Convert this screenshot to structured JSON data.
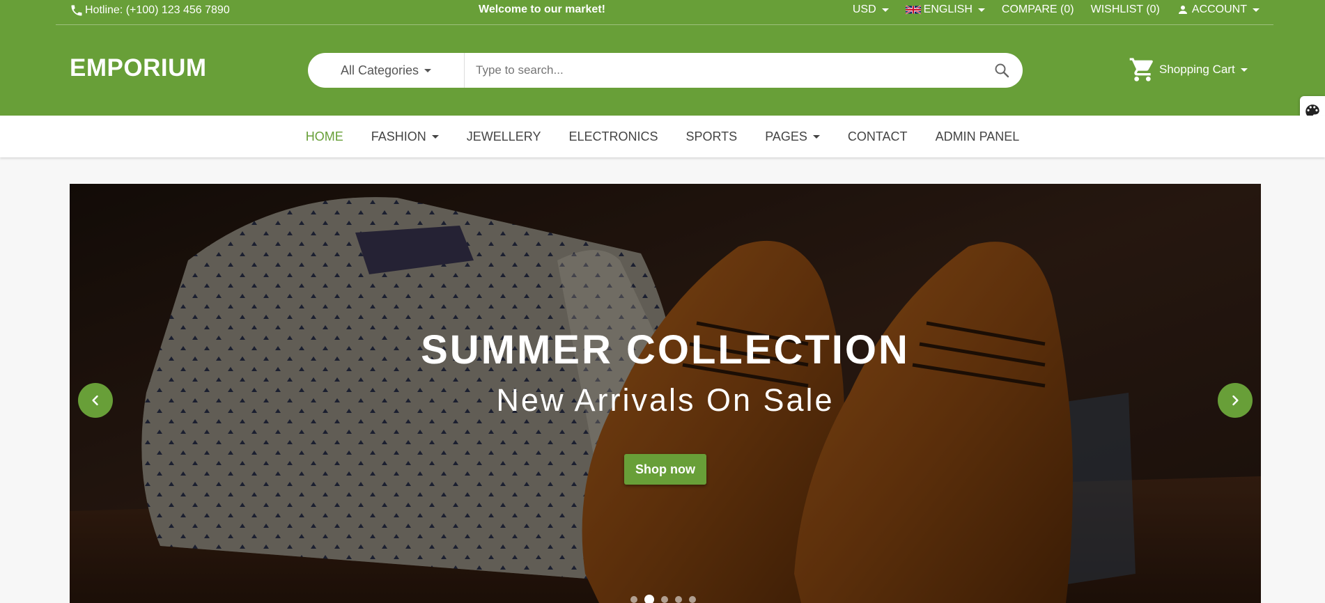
{
  "topbar": {
    "hotline": "Hotline: (+100) 123 456 7890",
    "welcome": "Welcome to our market!",
    "currency": "USD",
    "language": "ENGLISH",
    "compare": "COMPARE (0)",
    "wishlist": "WISHLIST (0)",
    "account": "ACCOUNT"
  },
  "header": {
    "logo": "EMPORIUM",
    "category_select": "All Categories",
    "search_placeholder": "Type to search...",
    "cart_label": "Shopping Cart"
  },
  "nav": {
    "items": [
      {
        "label": "HOME",
        "active": true
      },
      {
        "label": "FASHION",
        "dropdown": true
      },
      {
        "label": "JEWELLERY"
      },
      {
        "label": "ELECTRONICS"
      },
      {
        "label": "SPORTS"
      },
      {
        "label": "PAGES",
        "dropdown": true
      },
      {
        "label": "CONTACT"
      },
      {
        "label": "ADMIN PANEL"
      }
    ]
  },
  "hero": {
    "title": "SUMMER COLLECTION",
    "subtitle": "New Arrivals On Sale",
    "button": "Shop now",
    "slide_count": 5,
    "active_slide": 2
  },
  "colors": {
    "brand": "#689f38",
    "nav_active": "#689f38"
  },
  "icons": [
    "phone-icon",
    "uk-flag-icon",
    "user-icon",
    "search-icon",
    "cart-icon",
    "palette-icon",
    "chevron-left-icon",
    "chevron-right-icon"
  ]
}
